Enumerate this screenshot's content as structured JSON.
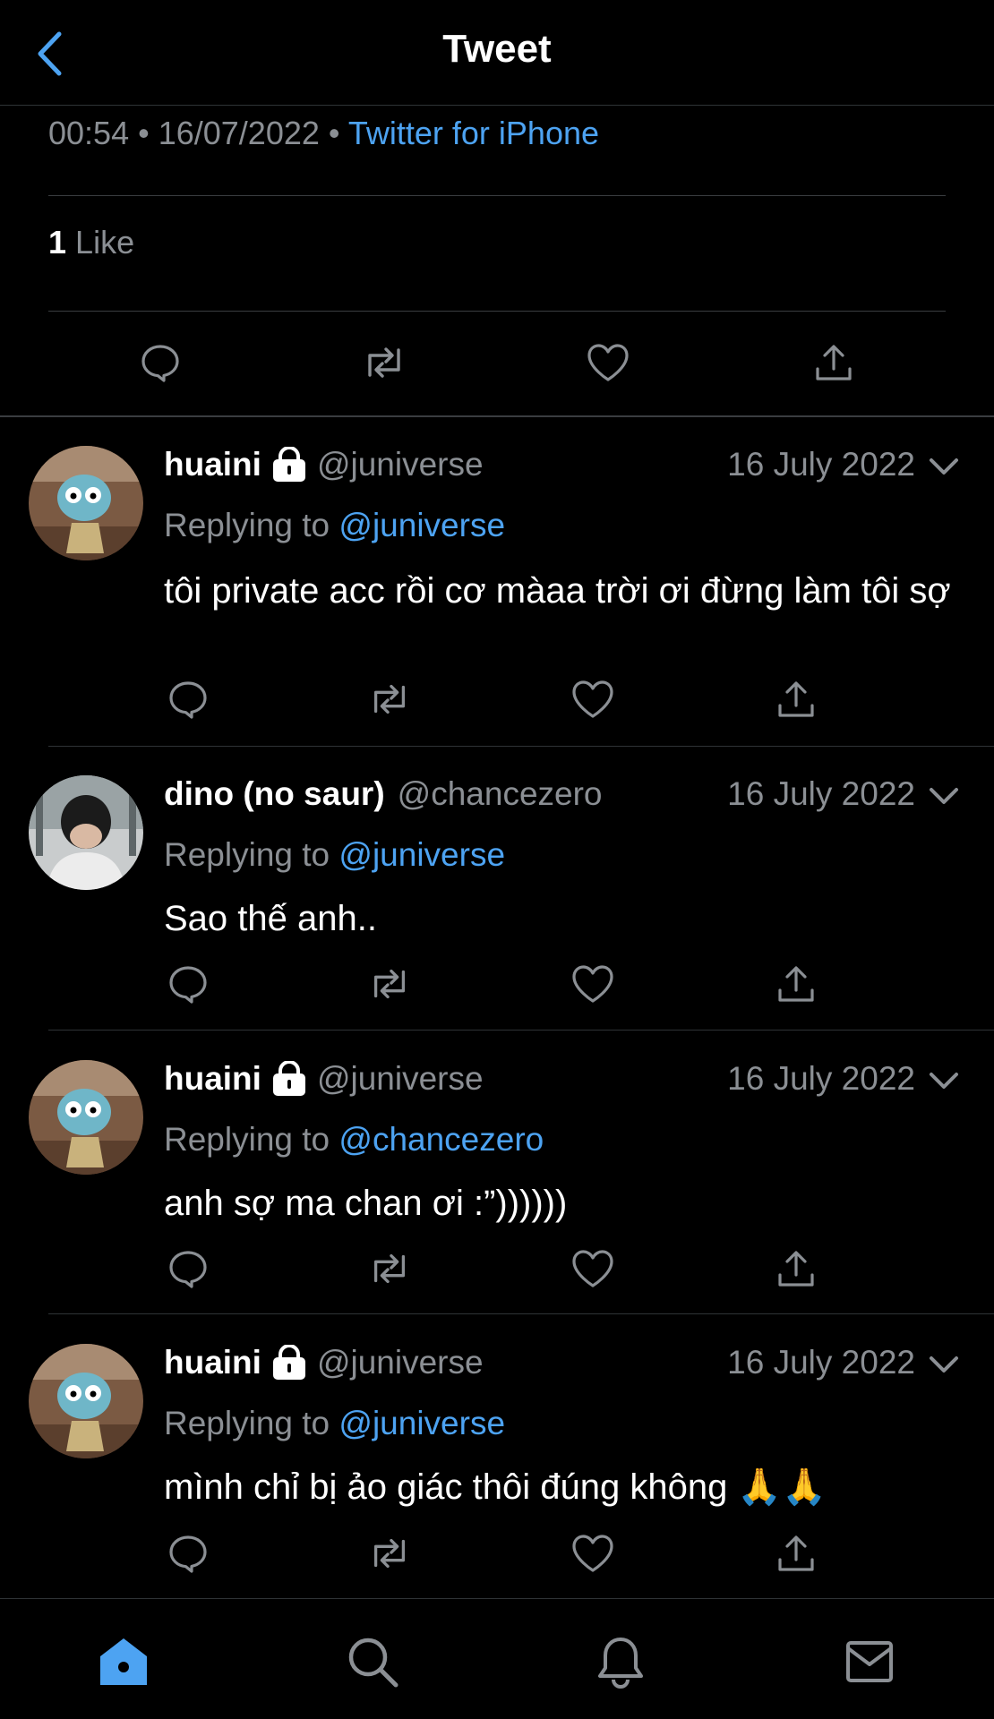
{
  "header": {
    "title": "Tweet"
  },
  "main_tweet": {
    "time": "00:54",
    "date": "16/07/2022",
    "source": "Twitter for iPhone",
    "likes_count": "1",
    "likes_label": "Like"
  },
  "replies": [
    {
      "name": "huaini",
      "handle": "@juniverse",
      "protected": true,
      "date": "16 July 2022",
      "replying_prefix": "Replying to",
      "replying_to": "@juniverse",
      "text": "tôi private acc rồi cơ màaa trời ơi đừng làm tôi sợ"
    },
    {
      "name": "dino (no saur)",
      "handle": "@chancezero",
      "protected": false,
      "date": "16 July 2022",
      "replying_prefix": "Replying to",
      "replying_to": "@juniverse",
      "text": "Sao thế anh.."
    },
    {
      "name": "huaini",
      "handle": "@juniverse",
      "protected": true,
      "date": "16 July 2022",
      "replying_prefix": "Replying to",
      "replying_to": "@chancezero",
      "text": "anh sợ ma chan ơi :”))))))"
    },
    {
      "name": "huaini",
      "handle": "@juniverse",
      "protected": true,
      "date": "16 July 2022",
      "replying_prefix": "Replying to",
      "replying_to": "@juniverse",
      "text": "mình chỉ bị ảo giác thôi đúng không 🙏🙏"
    }
  ],
  "tabbar": {
    "items": [
      "home-icon",
      "search-icon",
      "notifications-icon",
      "messages-icon"
    ],
    "active": "home-icon"
  },
  "colors": {
    "accent": "#4da3f2",
    "background": "#000000",
    "secondary_text": "#8b8f94",
    "divider": "#2f3336"
  }
}
